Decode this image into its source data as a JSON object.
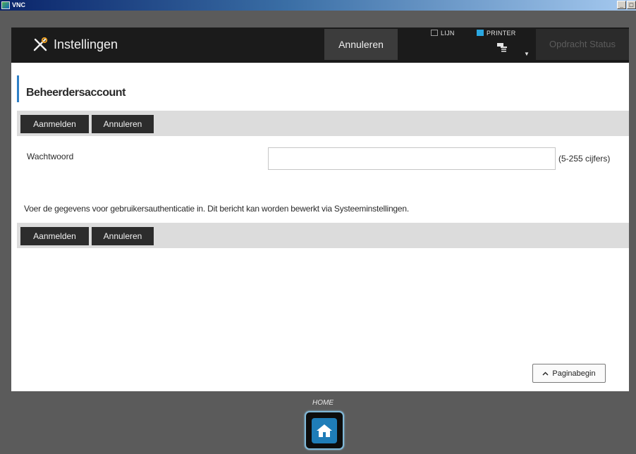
{
  "window": {
    "title": "VNC",
    "minimize": "_",
    "restore": "□"
  },
  "header": {
    "title": "Instellingen",
    "cancel_label": "Annuleren",
    "indicator_lijn": "LIJN",
    "indicator_printer": "PRINTER",
    "job_status_label": "Opdracht Status",
    "printer_color": "#2aa7e0"
  },
  "section": {
    "title": "Beheerdersaccount"
  },
  "actions": {
    "login_label": "Aanmelden",
    "cancel_label": "Annuleren"
  },
  "form": {
    "password_label": "Wachtwoord",
    "password_value": "",
    "password_hint": "(5-255 cijfers)"
  },
  "message": "Voer de gegevens voor gebruikersauthenticatie in. Dit bericht kan worden bewerkt via Systeeminstellingen.",
  "footer": {
    "page_top_label": "Paginabegin",
    "home_label": "HOME"
  },
  "icons": [
    "vnc-logo-icon",
    "tools-icon",
    "printer-icon",
    "caret-down-icon",
    "caret-up-icon",
    "home-icon"
  ],
  "colors": {
    "accent": "#2f80c6",
    "header_bg": "#1b1b1b",
    "button_dark": "#2c2c2c"
  }
}
